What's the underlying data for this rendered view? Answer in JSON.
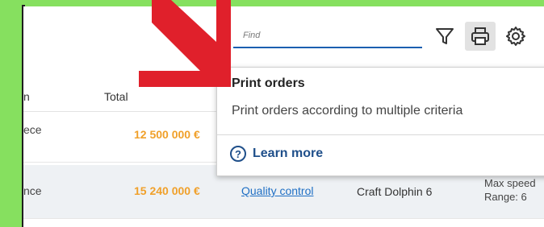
{
  "table": {
    "headers": {
      "partial_col": "n",
      "total": "Total"
    },
    "rows": [
      {
        "name_fragment": "ece",
        "amount": "12 500 000 €"
      },
      {
        "name_fragment": "nce",
        "amount": "15 240 000 €",
        "action": "Quality control",
        "craft": "Craft Dolphin 6",
        "spec_line1": "Max speed",
        "spec_line2": "Range: 6"
      }
    ]
  },
  "toolbar": {
    "search_placeholder": "Find",
    "icons": [
      "filter-icon",
      "print-icon",
      "gear-icon"
    ]
  },
  "popover": {
    "title": "Print orders",
    "description": "Print orders according to multiple criteria",
    "learn_more": "Learn more"
  },
  "colors": {
    "background_green": "#86e05f",
    "amount_orange": "#f0a02a",
    "link_blue": "#1f6fc4",
    "accent_blue": "#1b5fb0",
    "arrow_red": "#e0202b"
  }
}
